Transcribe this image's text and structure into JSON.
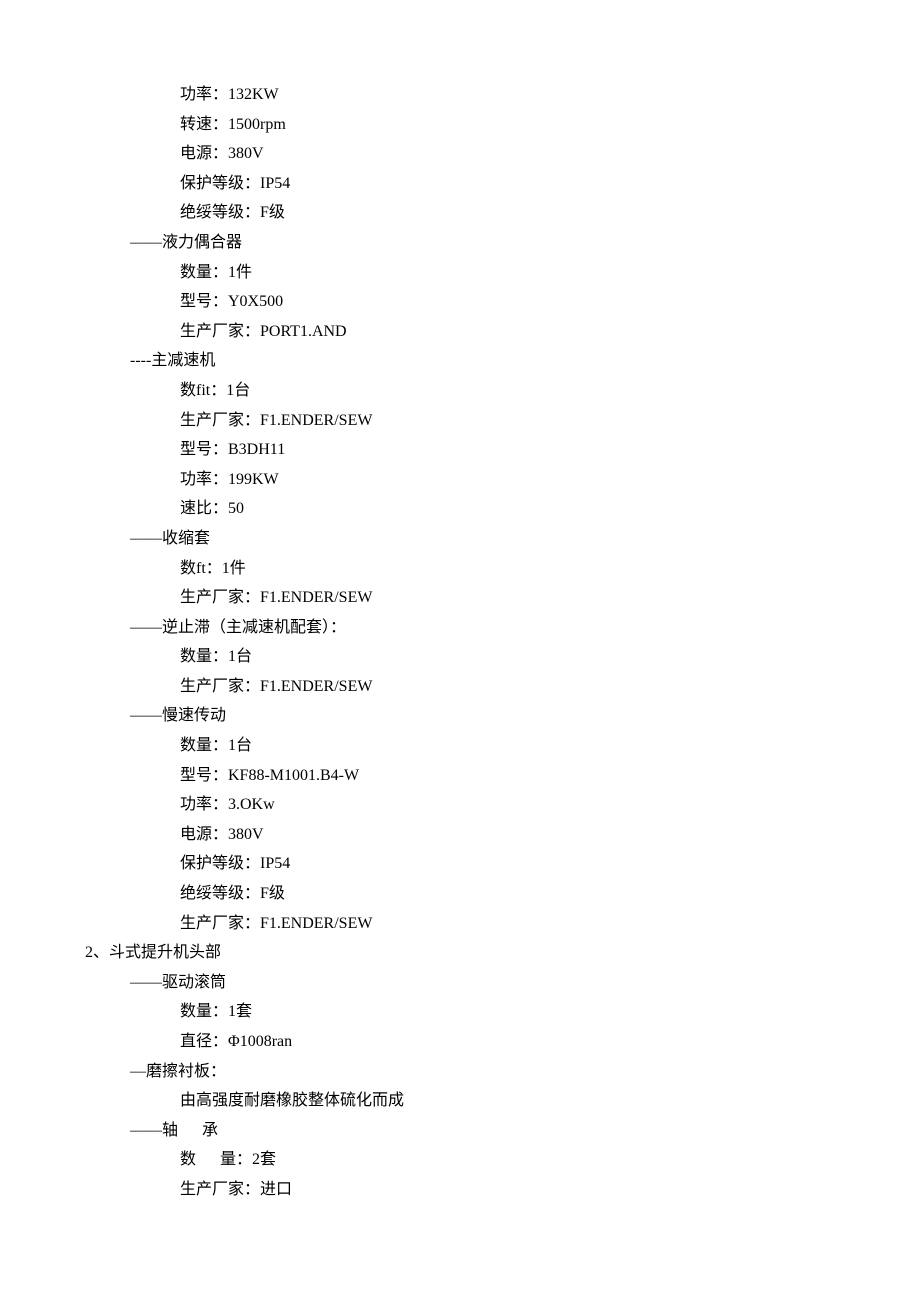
{
  "s0": {
    "l1": "功率：132KW",
    "l2": "转速：1500rpm",
    "l3": "电源：380V",
    "l4": "保护等级：IP54",
    "l5": "绝绥等级：F级"
  },
  "s1": {
    "title": "——液力偶合器",
    "l1": "数量：1件",
    "l2": "型号：Y0X500",
    "l3": "生产厂家：PORT1.AND"
  },
  "s2": {
    "title": "----主减速机",
    "l1": "数fit：1台",
    "l2": "生产厂家：F1.ENDER/SEW",
    "l3": "型号：B3DH11",
    "l4": "功率：199KW",
    "l5": "速比：50"
  },
  "s3": {
    "title": "——收缩套",
    "l1": "数ft：1件",
    "l2": "生产厂家：F1.ENDER/SEW"
  },
  "s4": {
    "title": "——逆止滞（主减速机配套）：",
    "l1": "数量：1台",
    "l2": "生产厂家：F1.ENDER/SEW"
  },
  "s5": {
    "title": "——慢速传动",
    "l1": "数量：1台",
    "l2": "型号：KF88-M1001.B4-W",
    "l3": "功率：3.OKw",
    "l4": "电源：380V",
    "l5": "保护等级：IP54",
    "l6": "绝绥等级：F级",
    "l7": "生产厂家：F1.ENDER/SEW"
  },
  "h2": "2、斗式提升机头部",
  "s6": {
    "title": "——驱动滚筒",
    "l1": "数量：1套",
    "l2": "直径：Φ1008ran"
  },
  "s7": {
    "title": "—磨擦衬板：",
    "l1": "由高强度耐磨橡胶整体硫化而成"
  },
  "s8": {
    "title": "——轴      承",
    "l1": "数      量：2套",
    "l2": "生产厂家：进口"
  }
}
